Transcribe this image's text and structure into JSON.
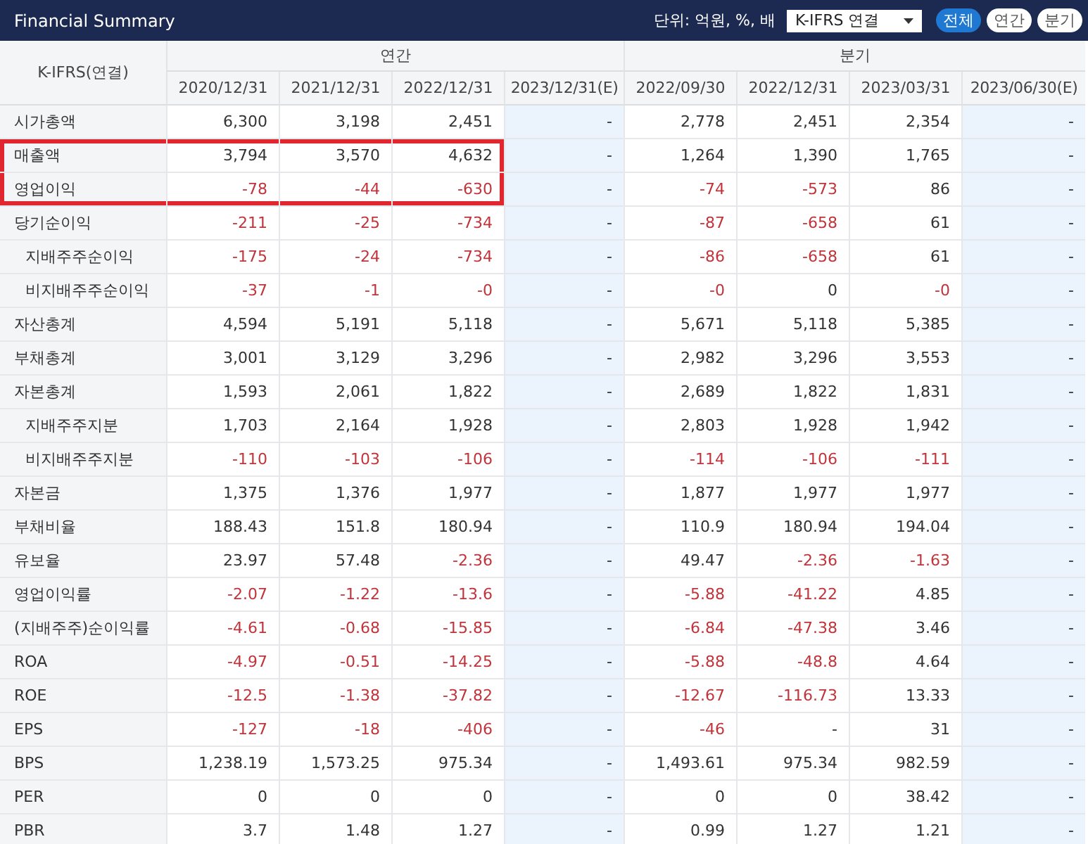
{
  "title": "Financial Summary",
  "unit_label": "단위: 억원, %, 배",
  "basis_select": {
    "value": "K-IFRS 연결"
  },
  "period_buttons": [
    {
      "label": "전체",
      "selected": true
    },
    {
      "label": "연간",
      "selected": false
    },
    {
      "label": "분기",
      "selected": false
    }
  ],
  "table": {
    "corner": "K-IFRS(연결)",
    "groups": [
      {
        "label": "연간",
        "columns": [
          {
            "label": "2020/12/31",
            "estimate": false
          },
          {
            "label": "2021/12/31",
            "estimate": false
          },
          {
            "label": "2022/12/31",
            "estimate": false
          },
          {
            "label": "2023/12/31(E)",
            "estimate": true
          }
        ]
      },
      {
        "label": "분기",
        "columns": [
          {
            "label": "2022/09/30",
            "estimate": false
          },
          {
            "label": "2022/12/31",
            "estimate": false
          },
          {
            "label": "2023/03/31",
            "estimate": false
          },
          {
            "label": "2023/06/30(E)",
            "estimate": true
          }
        ]
      }
    ],
    "rows": [
      {
        "label": "시가총액",
        "highlighted": false,
        "cells": [
          {
            "text": "6,300",
            "negative": false
          },
          {
            "text": "3,198",
            "negative": false
          },
          {
            "text": "2,451",
            "negative": false
          },
          {
            "text": "-",
            "negative": false
          },
          {
            "text": "2,778",
            "negative": false
          },
          {
            "text": "2,451",
            "negative": false
          },
          {
            "text": "2,354",
            "negative": false
          },
          {
            "text": "-",
            "negative": false
          }
        ]
      },
      {
        "label": "매출액",
        "highlighted": true,
        "cells": [
          {
            "text": "3,794",
            "negative": false
          },
          {
            "text": "3,570",
            "negative": false
          },
          {
            "text": "4,632",
            "negative": false
          },
          {
            "text": "-",
            "negative": false
          },
          {
            "text": "1,264",
            "negative": false
          },
          {
            "text": "1,390",
            "negative": false
          },
          {
            "text": "1,765",
            "negative": false
          },
          {
            "text": "-",
            "negative": false
          }
        ]
      },
      {
        "label": "영업이익",
        "highlighted": true,
        "cells": [
          {
            "text": "-78",
            "negative": true
          },
          {
            "text": "-44",
            "negative": true
          },
          {
            "text": "-630",
            "negative": true
          },
          {
            "text": "-",
            "negative": false
          },
          {
            "text": "-74",
            "negative": true
          },
          {
            "text": "-573",
            "negative": true
          },
          {
            "text": "86",
            "negative": false
          },
          {
            "text": "-",
            "negative": false
          }
        ]
      },
      {
        "label": "당기순이익",
        "highlighted": false,
        "cells": [
          {
            "text": "-211",
            "negative": true
          },
          {
            "text": "-25",
            "negative": true
          },
          {
            "text": "-734",
            "negative": true
          },
          {
            "text": "-",
            "negative": false
          },
          {
            "text": "-87",
            "negative": true
          },
          {
            "text": "-658",
            "negative": true
          },
          {
            "text": "61",
            "negative": false
          },
          {
            "text": "-",
            "negative": false
          }
        ],
        "children": [
          {
            "label": "지배주주순이익",
            "highlighted": false,
            "cells": [
              {
                "text": "-175",
                "negative": true
              },
              {
                "text": "-24",
                "negative": true
              },
              {
                "text": "-734",
                "negative": true
              },
              {
                "text": "-",
                "negative": false
              },
              {
                "text": "-86",
                "negative": true
              },
              {
                "text": "-658",
                "negative": true
              },
              {
                "text": "61",
                "negative": false
              },
              {
                "text": "-",
                "negative": false
              }
            ]
          },
          {
            "label": "비지배주주순이익",
            "highlighted": false,
            "cells": [
              {
                "text": "-37",
                "negative": true
              },
              {
                "text": "-1",
                "negative": true
              },
              {
                "text": "-0",
                "negative": true
              },
              {
                "text": "-",
                "negative": false
              },
              {
                "text": "-0",
                "negative": true
              },
              {
                "text": "0",
                "negative": false
              },
              {
                "text": "-0",
                "negative": true
              },
              {
                "text": "-",
                "negative": false
              }
            ]
          }
        ]
      },
      {
        "label": "자산총계",
        "highlighted": false,
        "cells": [
          {
            "text": "4,594",
            "negative": false
          },
          {
            "text": "5,191",
            "negative": false
          },
          {
            "text": "5,118",
            "negative": false
          },
          {
            "text": "-",
            "negative": false
          },
          {
            "text": "5,671",
            "negative": false
          },
          {
            "text": "5,118",
            "negative": false
          },
          {
            "text": "5,385",
            "negative": false
          },
          {
            "text": "-",
            "negative": false
          }
        ]
      },
      {
        "label": "부채총계",
        "highlighted": false,
        "cells": [
          {
            "text": "3,001",
            "negative": false
          },
          {
            "text": "3,129",
            "negative": false
          },
          {
            "text": "3,296",
            "negative": false
          },
          {
            "text": "-",
            "negative": false
          },
          {
            "text": "2,982",
            "negative": false
          },
          {
            "text": "3,296",
            "negative": false
          },
          {
            "text": "3,553",
            "negative": false
          },
          {
            "text": "-",
            "negative": false
          }
        ]
      },
      {
        "label": "자본총계",
        "highlighted": false,
        "cells": [
          {
            "text": "1,593",
            "negative": false
          },
          {
            "text": "2,061",
            "negative": false
          },
          {
            "text": "1,822",
            "negative": false
          },
          {
            "text": "-",
            "negative": false
          },
          {
            "text": "2,689",
            "negative": false
          },
          {
            "text": "1,822",
            "negative": false
          },
          {
            "text": "1,831",
            "negative": false
          },
          {
            "text": "-",
            "negative": false
          }
        ],
        "children": [
          {
            "label": "지배주주지분",
            "highlighted": false,
            "cells": [
              {
                "text": "1,703",
                "negative": false
              },
              {
                "text": "2,164",
                "negative": false
              },
              {
                "text": "1,928",
                "negative": false
              },
              {
                "text": "-",
                "negative": false
              },
              {
                "text": "2,803",
                "negative": false
              },
              {
                "text": "1,928",
                "negative": false
              },
              {
                "text": "1,942",
                "negative": false
              },
              {
                "text": "-",
                "negative": false
              }
            ]
          },
          {
            "label": "비지배주주지분",
            "highlighted": false,
            "cells": [
              {
                "text": "-110",
                "negative": true
              },
              {
                "text": "-103",
                "negative": true
              },
              {
                "text": "-106",
                "negative": true
              },
              {
                "text": "-",
                "negative": false
              },
              {
                "text": "-114",
                "negative": true
              },
              {
                "text": "-106",
                "negative": true
              },
              {
                "text": "-111",
                "negative": true
              },
              {
                "text": "-",
                "negative": false
              }
            ]
          }
        ]
      },
      {
        "label": "자본금",
        "highlighted": false,
        "cells": [
          {
            "text": "1,375",
            "negative": false
          },
          {
            "text": "1,376",
            "negative": false
          },
          {
            "text": "1,977",
            "negative": false
          },
          {
            "text": "-",
            "negative": false
          },
          {
            "text": "1,877",
            "negative": false
          },
          {
            "text": "1,977",
            "negative": false
          },
          {
            "text": "1,977",
            "negative": false
          },
          {
            "text": "-",
            "negative": false
          }
        ]
      },
      {
        "label": "부채비율",
        "highlighted": false,
        "cells": [
          {
            "text": "188.43",
            "negative": false
          },
          {
            "text": "151.8",
            "negative": false
          },
          {
            "text": "180.94",
            "negative": false
          },
          {
            "text": "-",
            "negative": false
          },
          {
            "text": "110.9",
            "negative": false
          },
          {
            "text": "180.94",
            "negative": false
          },
          {
            "text": "194.04",
            "negative": false
          },
          {
            "text": "-",
            "negative": false
          }
        ]
      },
      {
        "label": "유보율",
        "highlighted": false,
        "cells": [
          {
            "text": "23.97",
            "negative": false
          },
          {
            "text": "57.48",
            "negative": false
          },
          {
            "text": "-2.36",
            "negative": true
          },
          {
            "text": "-",
            "negative": false
          },
          {
            "text": "49.47",
            "negative": false
          },
          {
            "text": "-2.36",
            "negative": true
          },
          {
            "text": "-1.63",
            "negative": true
          },
          {
            "text": "-",
            "negative": false
          }
        ]
      },
      {
        "label": "영업이익률",
        "highlighted": false,
        "cells": [
          {
            "text": "-2.07",
            "negative": true
          },
          {
            "text": "-1.22",
            "negative": true
          },
          {
            "text": "-13.6",
            "negative": true
          },
          {
            "text": "-",
            "negative": false
          },
          {
            "text": "-5.88",
            "negative": true
          },
          {
            "text": "-41.22",
            "negative": true
          },
          {
            "text": "4.85",
            "negative": false
          },
          {
            "text": "-",
            "negative": false
          }
        ]
      },
      {
        "label": "(지배주주)순이익률",
        "highlighted": false,
        "cells": [
          {
            "text": "-4.61",
            "negative": true
          },
          {
            "text": "-0.68",
            "negative": true
          },
          {
            "text": "-15.85",
            "negative": true
          },
          {
            "text": "-",
            "negative": false
          },
          {
            "text": "-6.84",
            "negative": true
          },
          {
            "text": "-47.38",
            "negative": true
          },
          {
            "text": "3.46",
            "negative": false
          },
          {
            "text": "-",
            "negative": false
          }
        ]
      },
      {
        "label": "ROA",
        "highlighted": false,
        "cells": [
          {
            "text": "-4.97",
            "negative": true
          },
          {
            "text": "-0.51",
            "negative": true
          },
          {
            "text": "-14.25",
            "negative": true
          },
          {
            "text": "-",
            "negative": false
          },
          {
            "text": "-5.88",
            "negative": true
          },
          {
            "text": "-48.8",
            "negative": true
          },
          {
            "text": "4.64",
            "negative": false
          },
          {
            "text": "-",
            "negative": false
          }
        ]
      },
      {
        "label": "ROE",
        "highlighted": false,
        "cells": [
          {
            "text": "-12.5",
            "negative": true
          },
          {
            "text": "-1.38",
            "negative": true
          },
          {
            "text": "-37.82",
            "negative": true
          },
          {
            "text": "-",
            "negative": false
          },
          {
            "text": "-12.67",
            "negative": true
          },
          {
            "text": "-116.73",
            "negative": true
          },
          {
            "text": "13.33",
            "negative": false
          },
          {
            "text": "-",
            "negative": false
          }
        ]
      },
      {
        "label": "EPS",
        "highlighted": false,
        "cells": [
          {
            "text": "-127",
            "negative": true
          },
          {
            "text": "-18",
            "negative": true
          },
          {
            "text": "-406",
            "negative": true
          },
          {
            "text": "-",
            "negative": false
          },
          {
            "text": "-46",
            "negative": true
          },
          {
            "text": "-",
            "negative": false
          },
          {
            "text": "31",
            "negative": false
          },
          {
            "text": "-",
            "negative": false
          }
        ]
      },
      {
        "label": "BPS",
        "highlighted": false,
        "cells": [
          {
            "text": "1,238.19",
            "negative": false
          },
          {
            "text": "1,573.25",
            "negative": false
          },
          {
            "text": "975.34",
            "negative": false
          },
          {
            "text": "-",
            "negative": false
          },
          {
            "text": "1,493.61",
            "negative": false
          },
          {
            "text": "975.34",
            "negative": false
          },
          {
            "text": "982.59",
            "negative": false
          },
          {
            "text": "-",
            "negative": false
          }
        ]
      },
      {
        "label": "PER",
        "highlighted": false,
        "cells": [
          {
            "text": "0",
            "negative": false
          },
          {
            "text": "0",
            "negative": false
          },
          {
            "text": "0",
            "negative": false
          },
          {
            "text": "-",
            "negative": false
          },
          {
            "text": "0",
            "negative": false
          },
          {
            "text": "0",
            "negative": false
          },
          {
            "text": "38.42",
            "negative": false
          },
          {
            "text": "-",
            "negative": false
          }
        ]
      },
      {
        "label": "PBR",
        "highlighted": false,
        "cells": [
          {
            "text": "3.7",
            "negative": false
          },
          {
            "text": "1.48",
            "negative": false
          },
          {
            "text": "1.27",
            "negative": false
          },
          {
            "text": "-",
            "negative": false
          },
          {
            "text": "0.99",
            "negative": false
          },
          {
            "text": "1.27",
            "negative": false
          },
          {
            "text": "1.21",
            "negative": false
          },
          {
            "text": "-",
            "negative": false
          }
        ]
      }
    ]
  }
}
